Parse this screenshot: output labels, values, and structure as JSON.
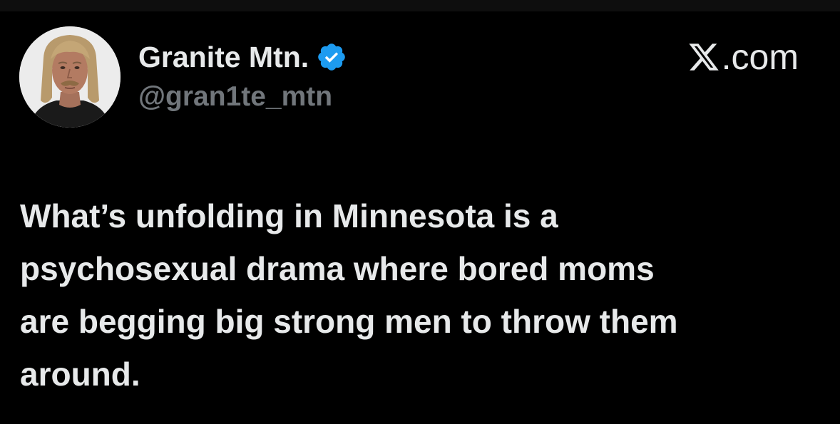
{
  "author": {
    "display_name": "Granite Mtn.",
    "handle": "@gran1te_mtn",
    "verified": true,
    "verified_badge_icon": "verified-badge-icon",
    "verified_color": "#1d9bf0",
    "avatar_icon": "profile-avatar"
  },
  "brand": {
    "logo_icon": "x-logo-icon",
    "label": ".com"
  },
  "tweet": {
    "text": "What’s unfolding in Minnesota is a\npsychosexual drama where bored moms\nare begging big strong men to throw them\naround."
  },
  "colors": {
    "background": "#000000",
    "primary_text": "#e7e9ea",
    "secondary_text": "#71767b"
  }
}
